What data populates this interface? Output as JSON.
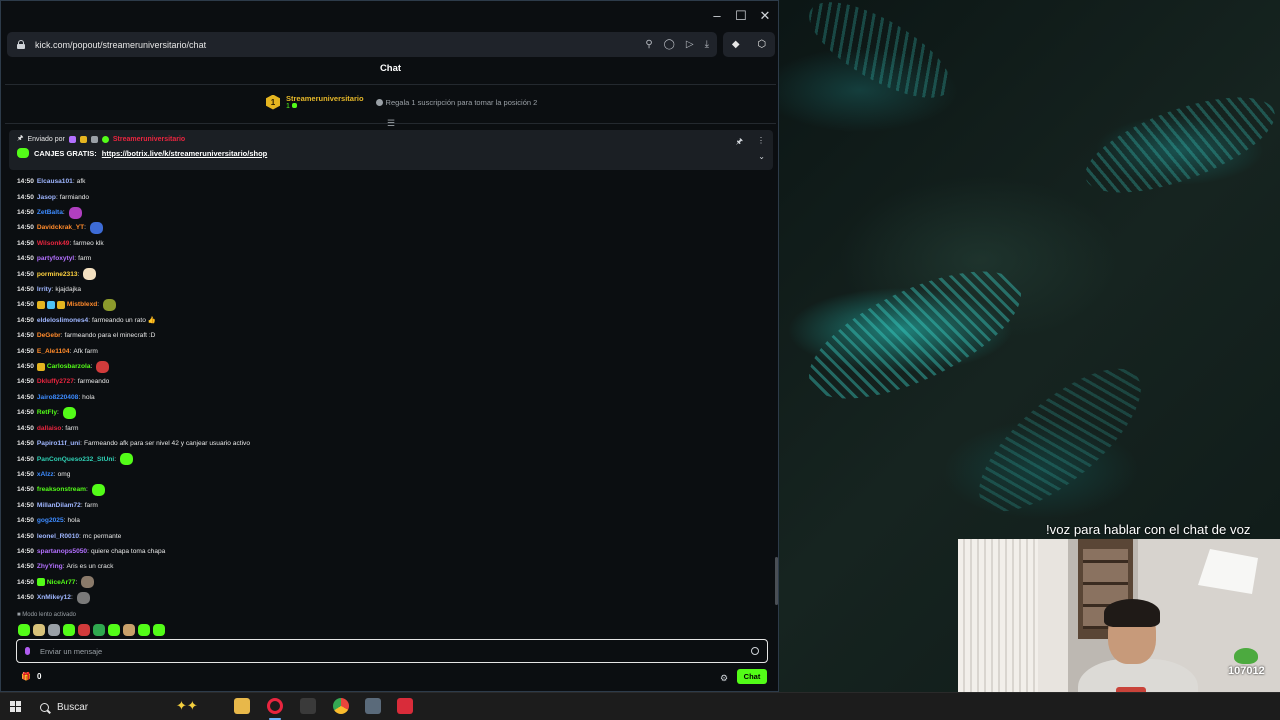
{
  "browser": {
    "url": "kick.com/popout/streameruniversitario/chat",
    "window_controls": [
      "minimize",
      "maximize",
      "close"
    ]
  },
  "chat": {
    "title": "Chat",
    "leader": {
      "rank": "1",
      "name": "Streameruniversitario",
      "count": "1",
      "gift_text": "Regala 1 suscripción para tomar la posición 2"
    },
    "pinned": {
      "sent_by_label": "Enviado por",
      "sender": "Streameruniversitario",
      "text": "CANJES GRATIS:",
      "link": "https://botrix.live/k/streameruniversitario/shop"
    },
    "messages": [
      {
        "time": "14:50",
        "user": "Elcausa101",
        "color": "#9fb6ff",
        "text": "afk"
      },
      {
        "time": "14:50",
        "user": "Jasop",
        "color": "#9fb6ff",
        "text": "farmiando"
      },
      {
        "time": "14:50",
        "user": "ZetBalta",
        "color": "#3d8bff",
        "text": "",
        "emote": "#b03fc0"
      },
      {
        "time": "14:50",
        "user": "Davidckrak_YT",
        "color": "#ff8a2b",
        "text": "",
        "emote": "#3d6bd6"
      },
      {
        "time": "14:50",
        "user": "Wilsonk49",
        "color": "#e8253f",
        "text": "farmeo klk"
      },
      {
        "time": "14:50",
        "user": "partyfoxytyl",
        "color": "#b370ff",
        "text": "farm"
      },
      {
        "time": "14:50",
        "user": "pormine2313",
        "color": "#ffd23f",
        "text": "",
        "emote": "#f3e0c0"
      },
      {
        "time": "14:50",
        "user": "Irrity",
        "color": "#9fb6ff",
        "text": "kjajdajka"
      },
      {
        "time": "14:50",
        "user": "Mistblexd",
        "color": "#ff8a2b",
        "text": "",
        "emote": "#8c9a2c",
        "badges": [
          "#e5b520",
          "#4fc3f7",
          "#e5b520"
        ]
      },
      {
        "time": "14:50",
        "user": "eldeloslimones4",
        "color": "#9fb6ff",
        "text": "farmeando un rato 👍"
      },
      {
        "time": "14:50",
        "user": "DeGebr",
        "color": "#ff8a2b",
        "text": "farmeando para el minecraft :D"
      },
      {
        "time": "14:50",
        "user": "E_Ale1104",
        "color": "#ff8a2b",
        "text": "Afk farm"
      },
      {
        "time": "14:50",
        "user": "Carlosbarzola",
        "color": "#53fc18",
        "text": "",
        "emote": "#d13b3b",
        "badges": [
          "#e5b520"
        ]
      },
      {
        "time": "14:50",
        "user": "Dkluffy2727",
        "color": "#e8253f",
        "text": "farmeando"
      },
      {
        "time": "14:50",
        "user": "Jairo8220408",
        "color": "#3d8bff",
        "text": "hola"
      },
      {
        "time": "14:50",
        "user": "RetFly",
        "color": "#53fc18",
        "text": "",
        "emote": "#53fc18"
      },
      {
        "time": "14:50",
        "user": "dallaiso",
        "color": "#e8253f",
        "text": "farm"
      },
      {
        "time": "14:50",
        "user": "Papiro11f_uni",
        "color": "#9fb6ff",
        "text": "Farmeando afk para ser nivel 42 y canjear usuario activo"
      },
      {
        "time": "14:50",
        "user": "PanConQueso232_StUni",
        "color": "#2fd0b5",
        "text": "",
        "emote": "#53fc18"
      },
      {
        "time": "14:50",
        "user": "xAlzz",
        "color": "#3d8bff",
        "text": "omg"
      },
      {
        "time": "14:50",
        "user": "freaksonstream",
        "color": "#53fc18",
        "text": "",
        "emote": "#53fc18"
      },
      {
        "time": "14:50",
        "user": "MillanDilam72",
        "color": "#9fb6ff",
        "text": "farm"
      },
      {
        "time": "14:50",
        "user": "gog2025",
        "color": "#3d8bff",
        "text": "hola"
      },
      {
        "time": "14:50",
        "user": "leonel_R0010",
        "color": "#9fb6ff",
        "text": "mc permante"
      },
      {
        "time": "14:50",
        "user": "spartanops5050",
        "color": "#b370ff",
        "text": "quiere chapa toma chapa"
      },
      {
        "time": "14:50",
        "user": "ZhyYing",
        "color": "#b370ff",
        "text": "Aris es un crack"
      },
      {
        "time": "14:50",
        "user": "NiceAr77",
        "color": "#53fc18",
        "text": "",
        "emote": "#8a7a6a",
        "badges": [
          "#53fc18"
        ]
      },
      {
        "time": "14:50",
        "user": "XnMikey12",
        "color": "#9fb6ff",
        "text": "",
        "emote": "#7a7a7a"
      }
    ],
    "slow_mode": "Modo lento activado",
    "input_placeholder": "Enviar un mensaje",
    "points": "0",
    "chat_button": "Chat"
  },
  "overlay": {
    "caption": "!voz para hablar con el chat de voz",
    "counter": "107012"
  },
  "taskbar": {
    "search_label": "Buscar"
  }
}
